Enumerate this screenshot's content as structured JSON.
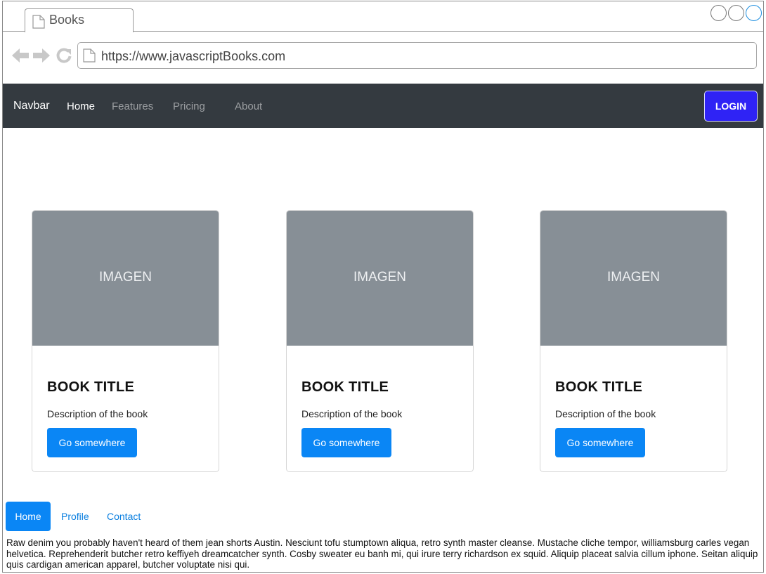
{
  "browser": {
    "tab_title": "Books",
    "url": "https://www.javascriptBooks.com"
  },
  "navbar": {
    "brand": "Navbar",
    "links": [
      "Home",
      "Features",
      "Pricing",
      "About"
    ],
    "active_link": "Home",
    "login_label": "LOGIN"
  },
  "cards": [
    {
      "image_label": "IMAGEN",
      "title": "BOOK TITLE",
      "description": "Description of the book",
      "button_label": "Go somewhere"
    },
    {
      "image_label": "IMAGEN",
      "title": "BOOK TITLE",
      "description": "Description of the book",
      "button_label": "Go somewhere"
    },
    {
      "image_label": "IMAGEN",
      "title": "BOOK TITLE",
      "description": "Description of the book",
      "button_label": "Go somewhere"
    }
  ],
  "pills": {
    "items": [
      "Home",
      "Profile",
      "Contact"
    ],
    "active": "Home"
  },
  "body_text": "Raw denim you probably haven't heard of them jean shorts Austin. Nesciunt tofu stumptown aliqua, retro synth master cleanse. Mustache cliche tempor, williamsburg carles vegan helvetica. Reprehenderit butcher retro keffiyeh dreamcatcher synth. Cosby sweater eu banh mi, qui irure terry richardson ex squid. Aliquip placeat salvia cillum iphone. Seitan aliquip quis cardigan american apparel, butcher voluptate nisi qui.",
  "colors": {
    "navbar_bg": "#343a40",
    "login_bg": "#2f23f5",
    "primary": "#0a86f5",
    "image_placeholder": "#878f96"
  },
  "icons": [
    "document-icon",
    "back-arrow-icon",
    "forward-arrow-icon",
    "reload-icon",
    "window-control-circle-icon"
  ]
}
